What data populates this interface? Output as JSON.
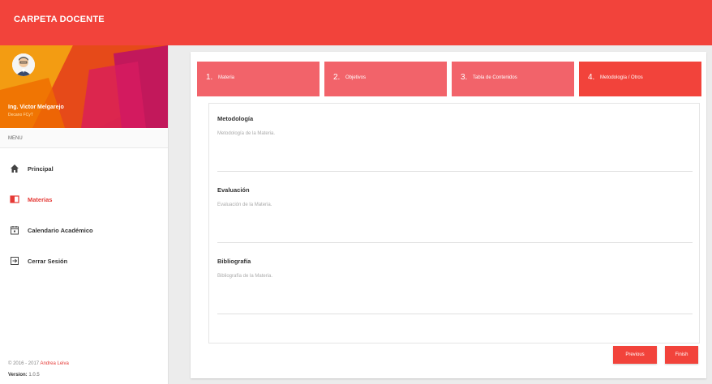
{
  "app": {
    "title": "CARPETA DOCENTE"
  },
  "user": {
    "name": "Ing. Victor Melgarejo",
    "role": "Decano FCyT"
  },
  "sidebar": {
    "menu_header": "MENU",
    "items": [
      {
        "label": "Principal",
        "icon": "home-icon"
      },
      {
        "label": "Materias",
        "icon": "book-icon",
        "active": true
      },
      {
        "label": "Calendario Académico",
        "icon": "calendar-icon"
      },
      {
        "label": "Cerrar Sesión",
        "icon": "logout-icon"
      }
    ],
    "footer": {
      "copyright": "© 2016 - 2017",
      "author": "Andrea Leiva",
      "version_label": "Version:",
      "version": "1.0.5"
    }
  },
  "steps": [
    {
      "num": "1.",
      "label": "Materia"
    },
    {
      "num": "2.",
      "label": "Objetivos"
    },
    {
      "num": "3.",
      "label": "Tabla de Contenidos"
    },
    {
      "num": "4.",
      "label": "Metodología / Otros"
    }
  ],
  "form": {
    "fields": [
      {
        "label": "Metodología",
        "placeholder": "Metodología de la Materia."
      },
      {
        "label": "Evaluación",
        "placeholder": "Evaluación de la Materia."
      },
      {
        "label": "Bibliografía",
        "placeholder": "Bibliografía de la Materia."
      }
    ]
  },
  "buttons": {
    "previous": "Previous",
    "finish": "Finish"
  },
  "colors": {
    "primary": "#f2433b",
    "step_inactive": "#f2636a",
    "active_text": "#e53935"
  }
}
